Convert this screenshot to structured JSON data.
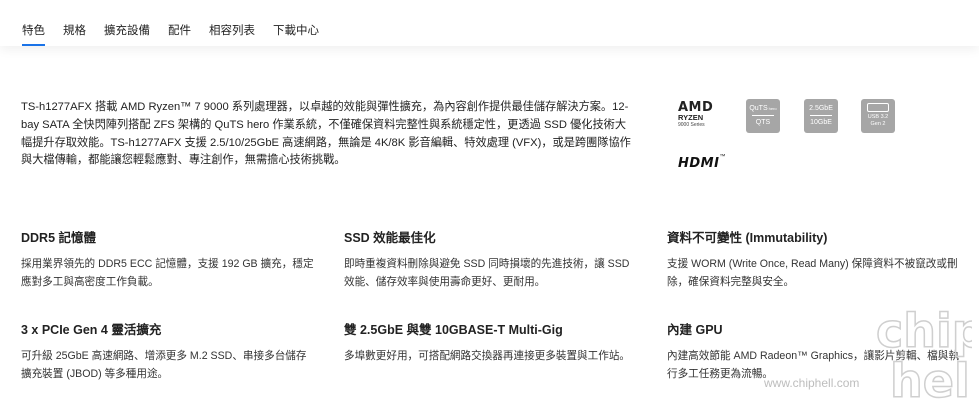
{
  "tabs": [
    {
      "label": "特色",
      "active": true
    },
    {
      "label": "規格",
      "active": false
    },
    {
      "label": "擴充設備",
      "active": false
    },
    {
      "label": "配件",
      "active": false
    },
    {
      "label": "相容列表",
      "active": false
    },
    {
      "label": "下載中心",
      "active": false
    }
  ],
  "accent_color": "#1a73e8",
  "intro": "TS-h1277AFX 搭載 AMD Ryzen™ 7 9000 系列處理器，以卓越的效能與彈性擴充，為內容創作提供最佳儲存解決方案。12-bay SATA 全快閃陣列搭配 ZFS 架構的 QuTS hero 作業系統，不僅確保資料完整性與系統穩定性，更透過 SSD 優化技術大幅提升存取效能。TS-h1277AFX 支援 2.5/10/25GbE 高速網路，無論是 4K/8K 影音編輯、特效處理 (VFX)，或是跨團隊協作與大檔傳輸，都能讓您輕鬆應對、專注創作，無需擔心技術挑戰。",
  "logos": {
    "amd": "AMD",
    "ryzen": "RYZEN",
    "ryzen_series": "9000 Series",
    "quts_top": "QuTS",
    "quts_small": "hero",
    "quts_bottom": "QTS",
    "net_top": "2.5GbE",
    "net_bottom": "10GbE",
    "usb_line1": "USB 3.2",
    "usb_line2": "Gen 2",
    "hdmi": "HDMI",
    "hdmi_tm": "™"
  },
  "features": [
    {
      "title": "DDR5 記憶體",
      "desc": "採用業界領先的 DDR5 ECC 記憶體，支援 192 GB 擴充，穩定應對多工與高密度工作負載。"
    },
    {
      "title": "SSD 效能最佳化",
      "desc": "即時重複資料刪除與避免 SSD 同時損壞的先進技術，讓 SSD 效能、儲存效率與使用壽命更好、更耐用。"
    },
    {
      "title": "資料不可變性 (Immutability)",
      "desc": "支援 WORM (Write Once, Read Many) 保障資料不被竄改或刪除，確保資料完整與安全。"
    },
    {
      "title": "3 x PCIe Gen 4 靈活擴充",
      "desc": "可升級 25GbE 高速網路、增添更多 M.2 SSD、串接多台儲存擴充裝置 (JBOD) 等多種用途。"
    },
    {
      "title": "雙 2.5GbE 與雙 10GBASE-T Multi-Gig",
      "desc": "多埠數更好用，可搭配網路交換器再連接更多裝置與工作站。"
    },
    {
      "title": "內建 GPU",
      "desc": "內建高效節能 AMD Radeon™ Graphics，讓影片剪輯、檔與執行多工任務更為流暢。"
    }
  ],
  "watermark": {
    "text": "www.chiphell.com",
    "logo_top": "chip",
    "logo_bottom": "hell"
  }
}
